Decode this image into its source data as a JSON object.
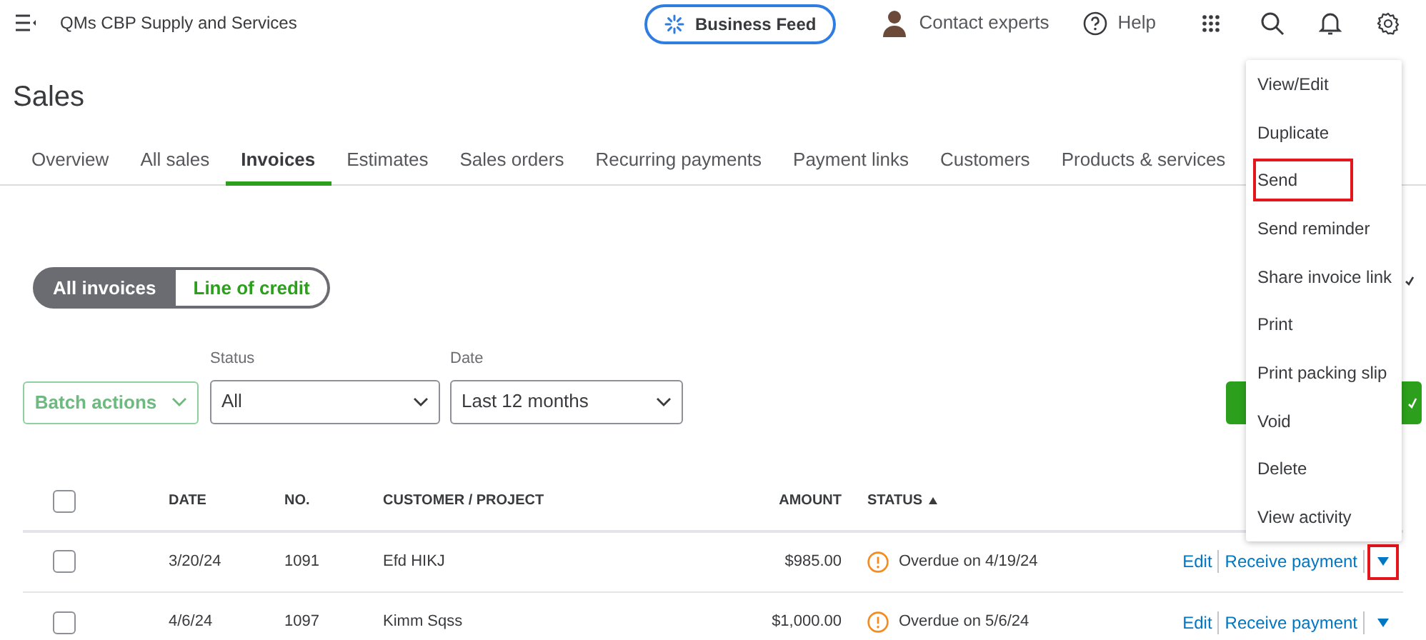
{
  "header": {
    "company": "QMs CBP Supply and Services",
    "business_feed": "Business Feed",
    "contact": "Contact experts",
    "help": "Help"
  },
  "page_title": "Sales",
  "tabs": [
    {
      "label": "Overview",
      "selected": false
    },
    {
      "label": "All sales",
      "selected": false
    },
    {
      "label": "Invoices",
      "selected": true
    },
    {
      "label": "Estimates",
      "selected": false
    },
    {
      "label": "Sales orders",
      "selected": false
    },
    {
      "label": "Recurring payments",
      "selected": false
    },
    {
      "label": "Payment links",
      "selected": false
    },
    {
      "label": "Customers",
      "selected": false
    },
    {
      "label": "Products & services",
      "selected": false
    }
  ],
  "segments": [
    {
      "label": "All invoices",
      "selected": true
    },
    {
      "label": "Line of credit",
      "selected": false
    }
  ],
  "batch_actions": "Batch actions",
  "filters": [
    {
      "label": "Status",
      "value": "All"
    },
    {
      "label": "Date",
      "value": "Last 12 months"
    }
  ],
  "table": {
    "select_all_checked": false,
    "columns": [
      {
        "label": "DATE",
        "sorted": false
      },
      {
        "label": "NO.",
        "sorted": false
      },
      {
        "label": "CUSTOMER / PROJECT",
        "sorted": false
      },
      {
        "label": "AMOUNT",
        "sorted": false
      },
      {
        "label": "STATUS",
        "sorted": true
      }
    ],
    "rows": [
      {
        "checked": false,
        "date": "3/20/24",
        "no": "1091",
        "customer": "Efd HIKJ",
        "amount": "$985.00",
        "status": "Overdue on 4/19/24",
        "edit": "Edit",
        "action": "Receive payment",
        "caret_highlighted": true
      },
      {
        "checked": false,
        "date": "4/6/24",
        "no": "1097",
        "customer": "Kimm Sqss",
        "amount": "$1,000.00",
        "status": "Overdue on 5/6/24",
        "edit": "Edit",
        "action": "Receive payment",
        "caret_highlighted": false
      }
    ]
  },
  "menu": {
    "items": [
      {
        "label": "View/Edit",
        "highlighted": false
      },
      {
        "label": "Duplicate",
        "highlighted": false
      },
      {
        "label": "Send",
        "highlighted": true
      },
      {
        "label": "Send reminder",
        "highlighted": false
      },
      {
        "label": "Share invoice link",
        "highlighted": false
      },
      {
        "label": "Print",
        "highlighted": false
      },
      {
        "label": "Print packing slip",
        "highlighted": false
      },
      {
        "label": "Void",
        "highlighted": false
      },
      {
        "label": "Delete",
        "highlighted": false
      },
      {
        "label": "View activity",
        "highlighted": false
      }
    ]
  }
}
